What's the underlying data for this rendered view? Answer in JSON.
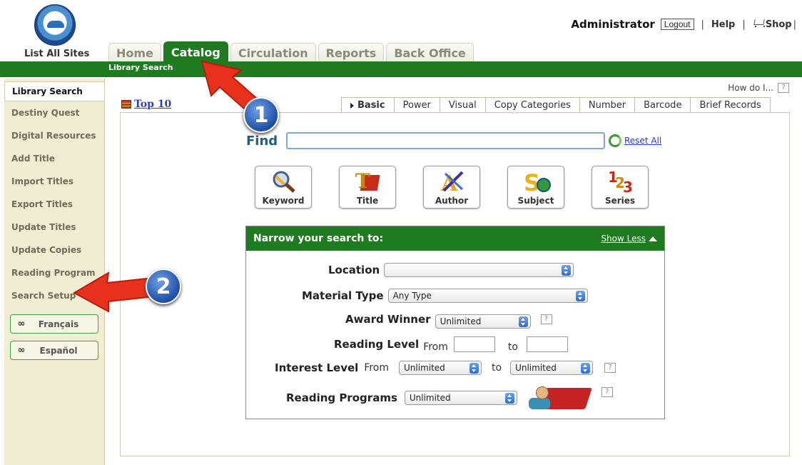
{
  "header": {
    "list_all_sites": "List All Sites",
    "user_name": "Administrator",
    "logout": "Logout",
    "separator": "|",
    "help": "Help",
    "shop": "Shop"
  },
  "tabs": [
    {
      "label": "Home",
      "active": false
    },
    {
      "label": "Catalog",
      "active": true
    },
    {
      "label": "Circulation",
      "active": false
    },
    {
      "label": "Reports",
      "active": false
    },
    {
      "label": "Back Office",
      "active": false
    }
  ],
  "sub_nav": {
    "label": "Library Search"
  },
  "sidebar": {
    "items": [
      {
        "label": "Library Search",
        "active": true
      },
      {
        "label": "Destiny Quest"
      },
      {
        "label": "Digital Resources"
      },
      {
        "label": "Add Title"
      },
      {
        "label": "Import Titles"
      },
      {
        "label": "Export Titles"
      },
      {
        "label": "Update Titles"
      },
      {
        "label": "Update Copies"
      },
      {
        "label": "Reading Program"
      },
      {
        "label": "Search Setup"
      }
    ],
    "languages": [
      {
        "label": "Français"
      },
      {
        "label": "Español"
      }
    ]
  },
  "content": {
    "how_do_i": "How do I...",
    "help_q": "?",
    "top10": "Top 10",
    "search_tabs": [
      {
        "label": "Basic",
        "active": true
      },
      {
        "label": "Power"
      },
      {
        "label": "Visual"
      },
      {
        "label": "Copy Categories"
      },
      {
        "label": "Number"
      },
      {
        "label": "Barcode"
      },
      {
        "label": "Brief Records"
      }
    ],
    "find_label": "Find",
    "find_value": "",
    "reset_all": "Reset All",
    "search_buttons": [
      {
        "label": "Keyword",
        "icon": "magnifier-icon"
      },
      {
        "label": "Title",
        "icon": "title-book-icon"
      },
      {
        "label": "Author",
        "icon": "author-pen-icon"
      },
      {
        "label": "Subject",
        "icon": "subject-globe-icon"
      },
      {
        "label": "Series",
        "icon": "series-123-icon"
      }
    ]
  },
  "narrow": {
    "title": "Narrow your search to:",
    "show_less": "Show Less",
    "location_label": "Location",
    "location_value": "",
    "material_label": "Material Type",
    "material_value": "Any Type",
    "award_label": "Award Winner",
    "award_value": "Unlimited",
    "reading_level_label": "Reading Level",
    "from": "From",
    "to": "to",
    "interest_label": "Interest Level",
    "interest_from_value": "Unlimited",
    "interest_to_value": "Unlimited",
    "programs_label": "Reading Programs",
    "programs_value": "Unlimited"
  },
  "annotations": {
    "badge1": "1",
    "badge2": "2",
    "arrow_color": "#e8311d"
  }
}
